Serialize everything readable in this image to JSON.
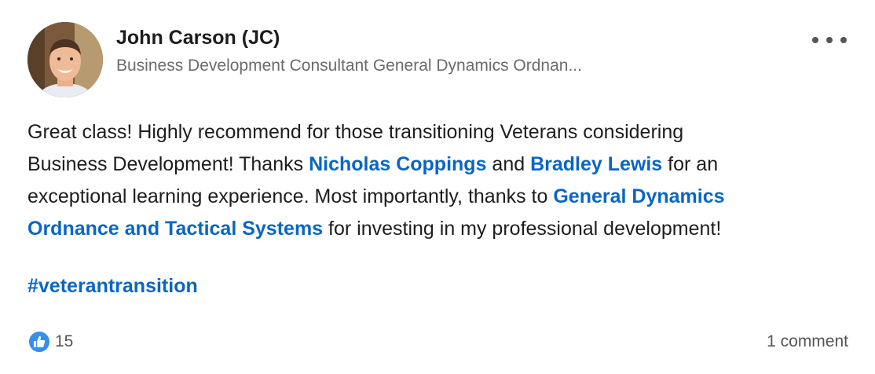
{
  "author": {
    "name": "John Carson (JC)",
    "headline": "Business Development Consultant General Dynamics Ordnan..."
  },
  "post": {
    "lines": [
      [
        {
          "text": "Great class! Highly recommend for those transitioning Veterans considering",
          "mention": false
        }
      ],
      [
        {
          "text": "Business Development! Thanks ",
          "mention": false
        },
        {
          "text": "Nicholas Coppings",
          "mention": true
        },
        {
          "text": " and ",
          "mention": false
        },
        {
          "text": "Bradley Lewis",
          "mention": true
        },
        {
          "text": " for an",
          "mention": false
        }
      ],
      [
        {
          "text": "exceptional learning experience. Most importantly, thanks to ",
          "mention": false
        },
        {
          "text": "General Dynamics",
          "mention": true
        }
      ],
      [
        {
          "text": "Ordnance and Tactical Systems",
          "mention": true
        },
        {
          "text": " for investing in my professional development!",
          "mention": false
        }
      ]
    ],
    "hashtag": "#veterantransition"
  },
  "social": {
    "reaction_icon": "like-icon",
    "reaction_count": "15",
    "comments": "1 comment"
  },
  "colors": {
    "link": "#0a66c2",
    "like_badge": "#378fe9"
  }
}
